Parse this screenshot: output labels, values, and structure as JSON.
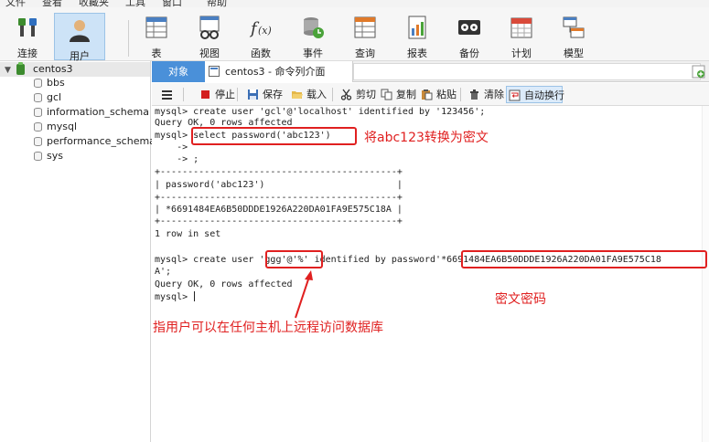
{
  "menu": [
    "文件",
    "查看",
    "收藏夹",
    "工具",
    "窗口",
    "帮助"
  ],
  "toolbar": {
    "items": [
      {
        "label": "连接",
        "icon": "connect-icon"
      },
      {
        "label": "用户",
        "icon": "user-icon",
        "active": true
      },
      {
        "label": "表",
        "icon": "table-icon"
      },
      {
        "label": "视图",
        "icon": "view-icon"
      },
      {
        "label": "函数",
        "icon": "function-icon"
      },
      {
        "label": "事件",
        "icon": "event-icon"
      },
      {
        "label": "查询",
        "icon": "query-icon"
      },
      {
        "label": "报表",
        "icon": "report-icon"
      },
      {
        "label": "备份",
        "icon": "backup-icon"
      },
      {
        "label": "计划",
        "icon": "schedule-icon"
      },
      {
        "label": "模型",
        "icon": "model-icon"
      }
    ]
  },
  "nav": {
    "connection": "centos3",
    "databases": [
      "bbs",
      "gcl",
      "information_schema",
      "mysql",
      "performance_schema",
      "sys"
    ]
  },
  "tabs": {
    "objects": "对象",
    "console": "centos3 - 命令列介面"
  },
  "console_toolbar": {
    "stop": "停止",
    "save": "保存",
    "load": "载入",
    "cut": "剪切",
    "copy": "复制",
    "paste": "粘贴",
    "clear": "清除",
    "autowrap": "自动换行"
  },
  "console": {
    "lines": [
      "mysql> create user 'gcl'@'localhost' identified by '123456';",
      "Query OK, 0 rows affected",
      "mysql> select password('abc123')",
      "    ->",
      "    -> ;",
      "+-------------------------------------------+",
      "| password('abc123')                        |",
      "+-------------------------------------------+",
      "| *6691484EA6B50DDDE1926A220DA01FA9E575C18A |",
      "+-------------------------------------------+",
      "1 row in set",
      "",
      "mysql> create user 'ggg'@'%' identified by password'*6691484EA6B50DDDE1926A220DA01FA9E575C18",
      "A';",
      "Query OK, 0 rows affected",
      "mysql> "
    ]
  },
  "annotations": {
    "convert": "将abc123转换为密文",
    "cipher": "密文密码",
    "anyhost": "指用户可以在任何主机上远程访问数据库"
  },
  "colors": {
    "annotation": "#e02020",
    "tab_active": "#4a90d9",
    "stop_red": "#d32020"
  }
}
